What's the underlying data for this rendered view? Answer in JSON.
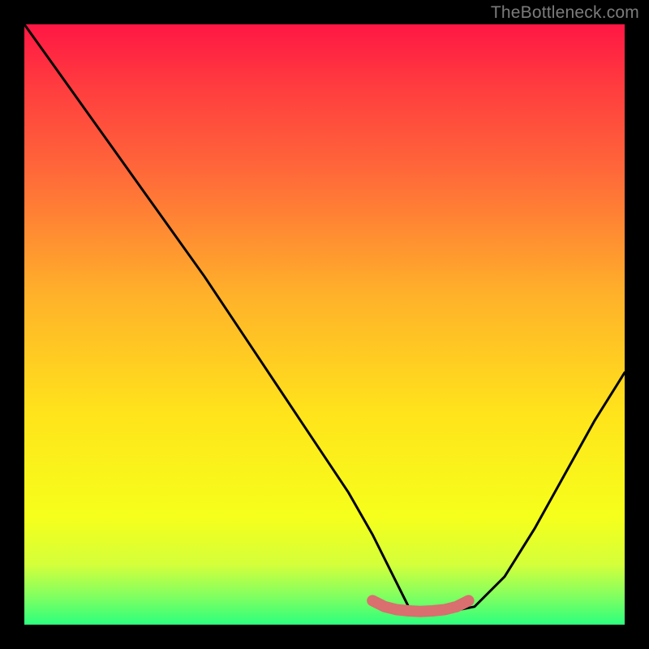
{
  "watermark": "TheBottleneck.com",
  "chart_data": {
    "type": "line",
    "title": "",
    "xlabel": "",
    "ylabel": "",
    "xlim": [
      0,
      100
    ],
    "ylim": [
      0,
      100
    ],
    "grid": false,
    "background_gradient": {
      "type": "vertical",
      "stops": [
        {
          "offset": 0.0,
          "color": "#ff1744"
        },
        {
          "offset": 0.1,
          "color": "#ff3b3f"
        },
        {
          "offset": 0.25,
          "color": "#ff6a39"
        },
        {
          "offset": 0.45,
          "color": "#ffb12a"
        },
        {
          "offset": 0.65,
          "color": "#ffe41b"
        },
        {
          "offset": 0.82,
          "color": "#f6ff1b"
        },
        {
          "offset": 0.9,
          "color": "#d4ff3a"
        },
        {
          "offset": 0.95,
          "color": "#86ff5e"
        },
        {
          "offset": 1.0,
          "color": "#2dff7e"
        }
      ]
    },
    "series": [
      {
        "name": "bottleneck-curve",
        "color": "#000000",
        "x": [
          0,
          5,
          10,
          15,
          20,
          25,
          30,
          34,
          38,
          42,
          46,
          50,
          54,
          58,
          62,
          64,
          65,
          70,
          75,
          80,
          85,
          90,
          95,
          100
        ],
        "values": [
          100,
          93,
          86,
          79,
          72,
          65,
          58,
          52,
          46,
          40,
          34,
          28,
          22,
          15,
          7,
          3,
          2,
          2,
          3,
          8,
          16,
          25,
          34,
          42
        ]
      }
    ],
    "optimal_marker": {
      "name": "optimal-range",
      "color": "#d96f6f",
      "x": [
        58,
        60,
        62,
        64,
        66,
        68,
        70,
        72,
        74
      ],
      "values": [
        4,
        3,
        2.5,
        2.3,
        2.2,
        2.3,
        2.5,
        3,
        4
      ]
    }
  }
}
